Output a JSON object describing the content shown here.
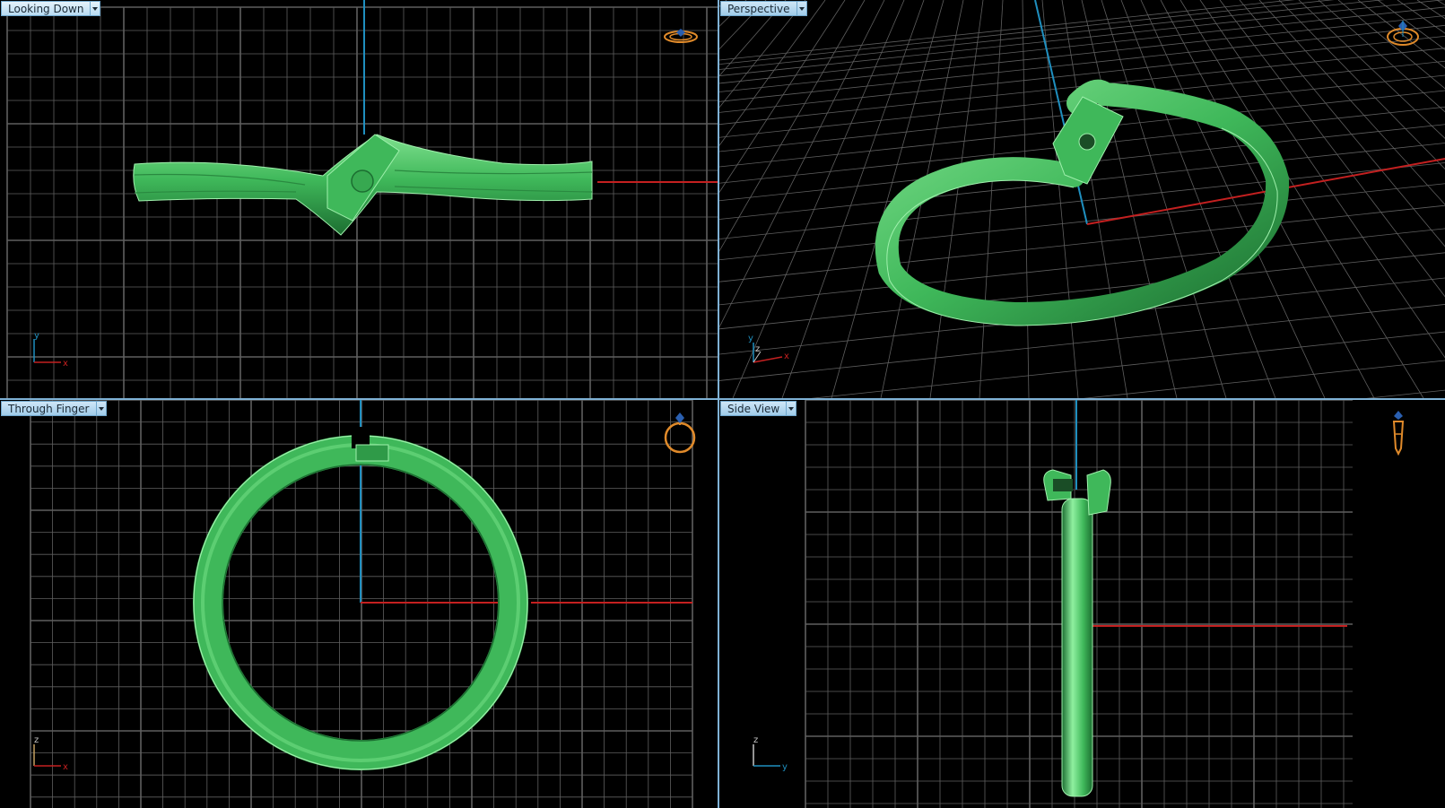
{
  "viewports": {
    "top_left": {
      "label": "Looking Down",
      "axis_a": "x",
      "axis_b": "y"
    },
    "top_right": {
      "label": "Perspective",
      "axis_a": "x",
      "axis_b": "y",
      "axis_c": "z"
    },
    "bottom_left": {
      "label": "Through Finger",
      "axis_a": "x",
      "axis_b": "z"
    },
    "bottom_right": {
      "label": "Side View",
      "axis_a": "y",
      "axis_b": "z"
    }
  },
  "colors": {
    "background": "#000000",
    "grid": "#5f5f5f",
    "axis_x": "#c42020",
    "axis_y": "#1f8fbf",
    "model": "#3fb85a",
    "nav_icon": "#e08a2a",
    "label_bg": "#a9d3ee"
  },
  "icons": [
    "ring-top-nav-icon",
    "ring-perspective-nav-icon",
    "ring-front-nav-icon",
    "ring-side-nav-icon",
    "dropdown-arrow-icon"
  ]
}
